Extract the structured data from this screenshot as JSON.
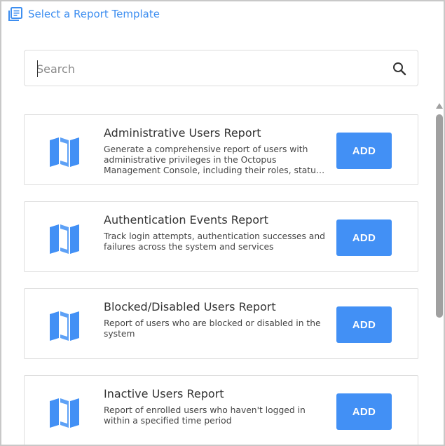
{
  "header": {
    "title": "Select a Report Template",
    "icon": "report-list-icon",
    "accent_color": "#3d8ef0"
  },
  "search": {
    "placeholder": "Search",
    "value": "",
    "icon": "search-icon"
  },
  "reports": [
    {
      "title": "Administrative Users Report",
      "description": "Generate a comprehensive report of users with administrative privileges in the Octopus Management Console, including their roles, status and activity.",
      "button_label": "ADD",
      "icon": "map-icon"
    },
    {
      "title": "Authentication Events Report",
      "description": "Track login attempts, authentication successes and failures across the system and services",
      "button_label": "ADD",
      "icon": "map-icon"
    },
    {
      "title": "Blocked/Disabled Users Report",
      "description": "Report of users who are blocked or disabled in the system",
      "button_label": "ADD",
      "icon": "map-icon"
    },
    {
      "title": "Inactive Users Report",
      "description": "Report of enrolled users who haven't logged in within a specified time period",
      "button_label": "ADD",
      "icon": "map-icon"
    }
  ],
  "colors": {
    "button": "#4290f5",
    "icon": "#3d8ef0"
  }
}
